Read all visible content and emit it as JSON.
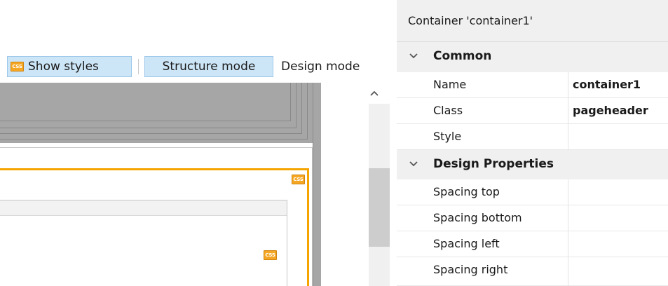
{
  "toolbar": {
    "show_styles_label": "Show styles",
    "css_badge": "CSS",
    "structure_mode_label": "Structure mode",
    "design_mode_label": "Design mode"
  },
  "canvas": {
    "css_badge_outer": "CSS",
    "css_badge_inner": "CSS"
  },
  "properties": {
    "title": "Container 'container1'",
    "categories": [
      {
        "label": "Common",
        "props": [
          {
            "name": "Name",
            "value": "container1"
          },
          {
            "name": "Class",
            "value": "pageheader"
          },
          {
            "name": "Style",
            "value": ""
          }
        ]
      },
      {
        "label": "Design Properties",
        "props": [
          {
            "name": "Spacing top",
            "value": ""
          },
          {
            "name": "Spacing bottom",
            "value": ""
          },
          {
            "name": "Spacing left",
            "value": ""
          },
          {
            "name": "Spacing right",
            "value": ""
          }
        ]
      }
    ]
  },
  "colors": {
    "accent_orange": "#f5a400",
    "toggle_blue": "#cde6f7",
    "panel_bg": "#f0f0f0",
    "canvas_grey": "#a6a6a6"
  },
  "icons": {
    "scroll_up": "chevron-up-icon",
    "category_expander": "chevron-down-icon",
    "css": "css-icon"
  }
}
